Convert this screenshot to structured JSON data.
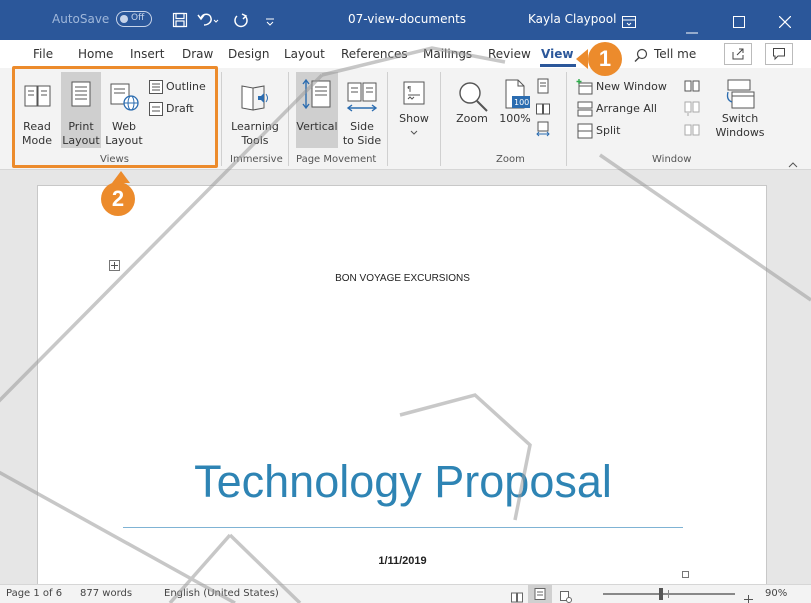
{
  "titlebar": {
    "autosave_label": "AutoSave",
    "autosave_state": "Off",
    "document_name": "07-view-documents",
    "user_name": "Kayla Claypool"
  },
  "tabs": [
    "File",
    "Home",
    "Insert",
    "Draw",
    "Design",
    "Layout",
    "References",
    "Mailings",
    "Review",
    "View"
  ],
  "tell_me": "Tell me",
  "ribbon": {
    "views": {
      "read_mode": [
        "Read",
        "Mode"
      ],
      "print_layout": [
        "Print",
        "Layout"
      ],
      "web_layout": [
        "Web",
        "Layout"
      ],
      "outline": "Outline",
      "draft": "Draft",
      "group_label": "Views"
    },
    "immersive": {
      "learning_tools": [
        "Learning",
        "Tools"
      ],
      "group_label": "Immersive"
    },
    "page_movement": {
      "vertical": "Vertical",
      "side_to_side": [
        "Side",
        "to Side"
      ],
      "group_label": "Page Movement"
    },
    "show": "Show",
    "zoom": {
      "zoom": "Zoom",
      "hundred": "100%",
      "badge": "100",
      "group_label": "Zoom"
    },
    "window": {
      "new_window": "New Window",
      "arrange_all": "Arrange All",
      "split": "Split",
      "switch_windows": [
        "Switch",
        "Windows"
      ],
      "group_label": "Window"
    }
  },
  "callouts": [
    "1",
    "2"
  ],
  "document": {
    "company": "BON VOYAGE EXCURSIONS",
    "title": "Technology Proposal",
    "date": "1/11/2019"
  },
  "statusbar": {
    "page": "Page 1 of 6",
    "words": "877 words",
    "language": "English (United States)",
    "zoom": "90%",
    "zoom_level": 0.9
  },
  "colors": {
    "title_bar": "#2b579a",
    "callout": "#ec8b2c",
    "title_text": "#2e84b4"
  }
}
